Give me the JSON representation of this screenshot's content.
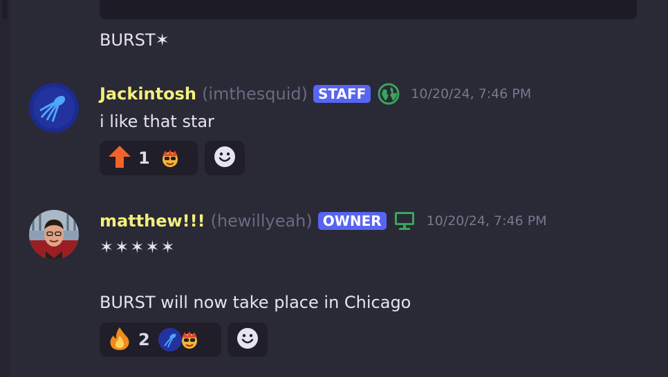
{
  "previous_message": {
    "text": "BURST✶"
  },
  "messages": [
    {
      "display_name": "Jackintosh",
      "username": "(imthesquid)",
      "role": "STAFF",
      "platform_icon": "globe-icon",
      "timestamp": "10/20/24, 7:46 PM",
      "lines": [
        "i like that star"
      ],
      "reactions": [
        {
          "emoji": "up-arrow-emoji",
          "count": "1"
        }
      ]
    },
    {
      "display_name": "matthew!!!",
      "username": "(hewillyeah)",
      "role": "OWNER",
      "platform_icon": "desktop-icon",
      "timestamp": "10/20/24, 7:46 PM",
      "lines": [
        "✶✶✶✶✶",
        "BURST will now take place in Chicago"
      ],
      "reactions": [
        {
          "emoji": "fire-emoji",
          "count": "2"
        }
      ]
    }
  ],
  "colors": {
    "background": "#2a2936",
    "display_name": "#f3f07c",
    "role_tag": "#5865f2",
    "globe": "#3ba55d",
    "desktop": "#3ba55d"
  }
}
